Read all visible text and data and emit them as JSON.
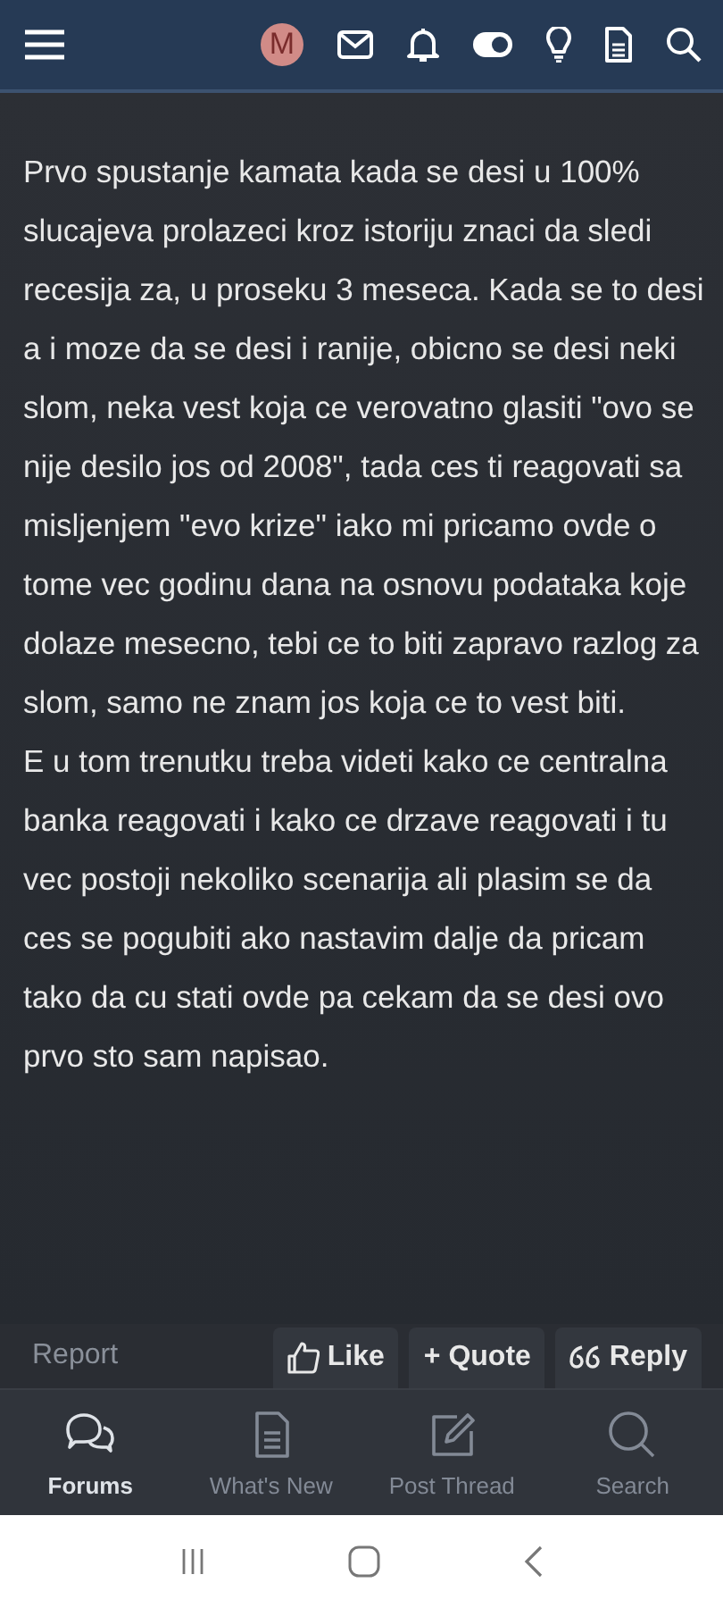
{
  "header": {
    "avatar_letter": "M"
  },
  "post": {
    "paragraphs": [
      "Prvo spustanje kamata kada se desi u 100% slucajeva prolazeci kroz istoriju znaci da sledi recesija za, u proseku 3 meseca. Kada se to desi a i moze da se desi i ranije, obicno se desi neki slom, neka vest koja ce verovatno glasiti \"ovo se nije desilo jos od 2008\", tada ces ti reagovati sa misljenjem \"evo krize\" iako mi pricamo ovde o tome vec godinu dana na osnovu podataka koje dolaze mesecno, tebi ce to biti zapravo razlog za slom, samo ne znam jos koja ce to vest biti.",
      "E u tom trenutku treba videti kako ce centralna banka reagovati i kako ce drzave reagovati i tu vec postoji nekoliko scenarija ali plasim se da ces se pogubiti ako nastavim dalje da pricam tako da cu stati ovde pa cekam da se desi ovo prvo sto sam napisao."
    ],
    "report": "Report",
    "actions": [
      {
        "kind": "like",
        "label": "Like"
      },
      {
        "kind": "quote",
        "label": "+ Quote"
      },
      {
        "kind": "reply",
        "label": "Reply"
      }
    ]
  },
  "bottom_nav": [
    {
      "kind": "forums",
      "label": "Forums",
      "selected": true
    },
    {
      "kind": "new",
      "label": "What's New",
      "selected": false
    },
    {
      "kind": "post",
      "label": "Post Thread",
      "selected": false
    },
    {
      "kind": "search",
      "label": "Search",
      "selected": false
    }
  ]
}
